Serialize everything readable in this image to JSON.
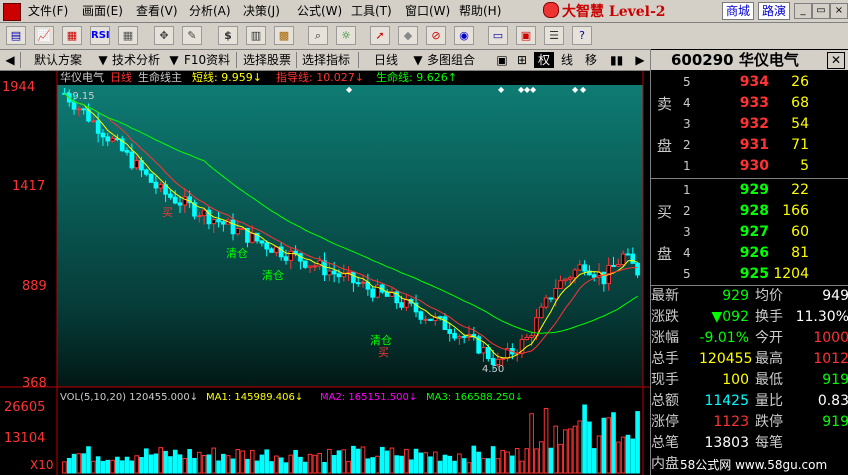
{
  "menu": [
    "文件(F)",
    "画面(E)",
    "查看(V)",
    "分析(A)",
    "决策(J)",
    "公式(W)",
    "工具(T)",
    "窗口(W)",
    "帮助(H)"
  ],
  "brand": "大智慧 Level-2",
  "tabs": [
    "商城",
    "路演"
  ],
  "subbar": {
    "default_scheme": "默认方案",
    "tech": "技术分析",
    "f10": "F10资料",
    "select_stock": "选择股票",
    "select_indicator": "选择指标",
    "period": "日线",
    "multi": "多图组合",
    "btn_quan": "权",
    "btn_xian": "线",
    "btn_yi": "移"
  },
  "stock": {
    "code": "600290",
    "name": "华仪电气",
    "header": "600290 华仪电气"
  },
  "orderbook": {
    "sell_label": [
      "卖",
      "盘"
    ],
    "buy_label": [
      "买",
      "盘"
    ],
    "sell": [
      {
        "lvl": "5",
        "price": "934",
        "vol": "26"
      },
      {
        "lvl": "4",
        "price": "933",
        "vol": "68"
      },
      {
        "lvl": "3",
        "price": "932",
        "vol": "54"
      },
      {
        "lvl": "2",
        "price": "931",
        "vol": "71"
      },
      {
        "lvl": "1",
        "price": "930",
        "vol": "5"
      }
    ],
    "buy": [
      {
        "lvl": "1",
        "price": "929",
        "vol": "22"
      },
      {
        "lvl": "2",
        "price": "928",
        "vol": "166"
      },
      {
        "lvl": "3",
        "price": "927",
        "vol": "60"
      },
      {
        "lvl": "4",
        "price": "926",
        "vol": "81"
      },
      {
        "lvl": "5",
        "price": "925",
        "vol": "1204"
      }
    ]
  },
  "quote": [
    {
      "l": "最新",
      "lv": "929",
      "lc": "#0f0",
      "r": "均价",
      "rv": "949",
      "rc": "#fff"
    },
    {
      "l": "涨跌",
      "lv": "▼092",
      "lc": "#0f0",
      "r": "换手",
      "rv": "11.30%",
      "rc": "#fff"
    },
    {
      "l": "涨幅",
      "lv": "-9.01%",
      "lc": "#0f0",
      "r": "今开",
      "rv": "1000",
      "rc": "#f33"
    },
    {
      "l": "总手",
      "lv": "120455",
      "lc": "#ff0",
      "r": "最高",
      "rv": "1012",
      "rc": "#f33"
    },
    {
      "l": "现手",
      "lv": "100",
      "lc": "#ff0",
      "r": "最低",
      "rv": "919",
      "rc": "#0f0"
    },
    {
      "l": "总额",
      "lv": "11425",
      "lc": "#0ff",
      "r": "量比",
      "rv": "0.83",
      "rc": "#fff"
    },
    {
      "l": "涨停",
      "lv": "1123",
      "lc": "#f33",
      "r": "跌停",
      "rv": "919",
      "rc": "#0f0"
    },
    {
      "l": "总笔",
      "lv": "13803",
      "lc": "#fff",
      "r": "每笔",
      "rv": "",
      "rc": "#fff"
    },
    {
      "l": "内盘",
      "lv": "",
      "lc": "#fff",
      "r": "",
      "rv": "",
      "rc": "#fff"
    }
  ],
  "chart_header": {
    "name": "华仪电气",
    "period": "日线",
    "indicator": "生命线主",
    "short_label": "短线: 9.959↓",
    "guide_label": "指导线: 10.027↓",
    "life_label": "生命线: 9.626↑"
  },
  "chart_data": {
    "type": "line",
    "ylim": [
      368,
      1944
    ],
    "y_ticks": [
      "1944",
      "1417",
      "889",
      "368"
    ],
    "max_annotation": "19.15",
    "min_annotation": "4.50",
    "signals": [
      "清仓",
      "清仓",
      "买",
      "清仓",
      "买"
    ],
    "volume": {
      "header": "VOL(5,10,20) 120455.000↓",
      "ma1": "MA1: 145989.406↓",
      "ma2": "MA2: 165151.500↓",
      "ma3": "MA3: 166588.250↓",
      "y_ticks": [
        "26605",
        "13104",
        "X10"
      ]
    }
  },
  "watermark": "58公式网 www.58gu.com"
}
